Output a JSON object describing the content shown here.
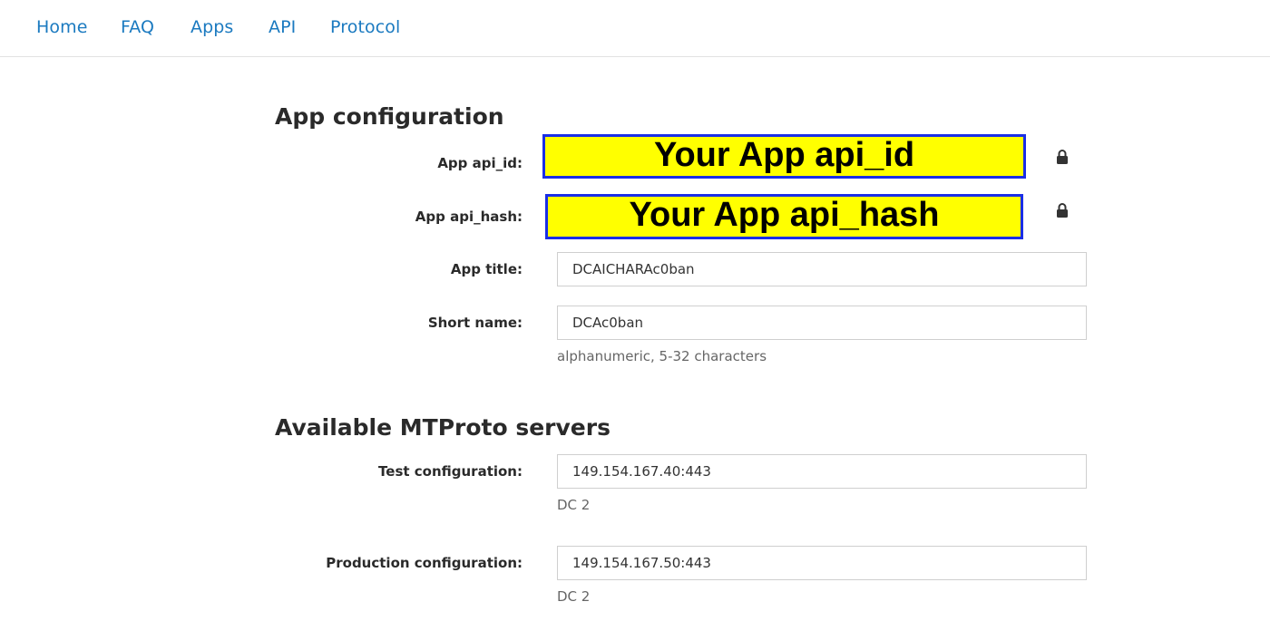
{
  "nav": {
    "items": [
      {
        "label": "Home"
      },
      {
        "label": "FAQ"
      },
      {
        "label": "Apps"
      },
      {
        "label": "API"
      },
      {
        "label": "Protocol"
      }
    ]
  },
  "app_config": {
    "heading": "App configuration",
    "api_id": {
      "label": "App api_id:",
      "value": "Your App api_id",
      "icon": "lock-icon"
    },
    "api_hash": {
      "label": "App api_hash:",
      "value": "Your App api_hash",
      "icon": "lock-icon"
    },
    "app_title": {
      "label": "App title:",
      "value": "DCAICHARAc0ban"
    },
    "short_name": {
      "label": "Short name:",
      "value": "DCAc0ban",
      "help": "alphanumeric, 5-32 characters"
    }
  },
  "servers": {
    "heading": "Available MTProto servers",
    "test": {
      "label": "Test configuration:",
      "value": "149.154.167.40:443",
      "dc": "DC 2"
    },
    "production": {
      "label": "Production configuration:",
      "value": "149.154.167.50:443",
      "dc": "DC 2"
    }
  },
  "colors": {
    "link": "#1b7ac0",
    "highlight": "#ffff00",
    "highlight_border": "#1a2ee6"
  }
}
